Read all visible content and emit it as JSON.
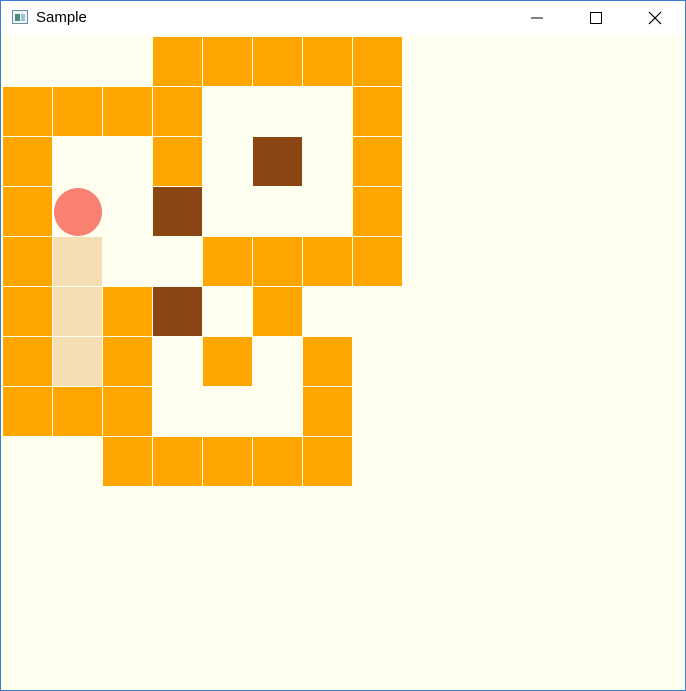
{
  "window": {
    "title": "Sample",
    "controls": [
      "minimize-icon",
      "maximize-icon",
      "close-icon"
    ]
  },
  "colors": {
    "background": "#fffff0",
    "wall": "#ffa500",
    "box": "#8b4513",
    "goal": "#f5deb3",
    "player": "#fa8072"
  },
  "level": {
    "rows": [
      "   #####",
      "####   #",
      "#  # $ #",
      "#@ $   #",
      "#.  ####",
      "#.#$ #",
      "#.# # #",
      "###   #",
      "  #####"
    ],
    "legend": {
      "#": "wall",
      "$": "box",
      ".": "goal",
      "@": "player",
      " ": "floor"
    }
  }
}
